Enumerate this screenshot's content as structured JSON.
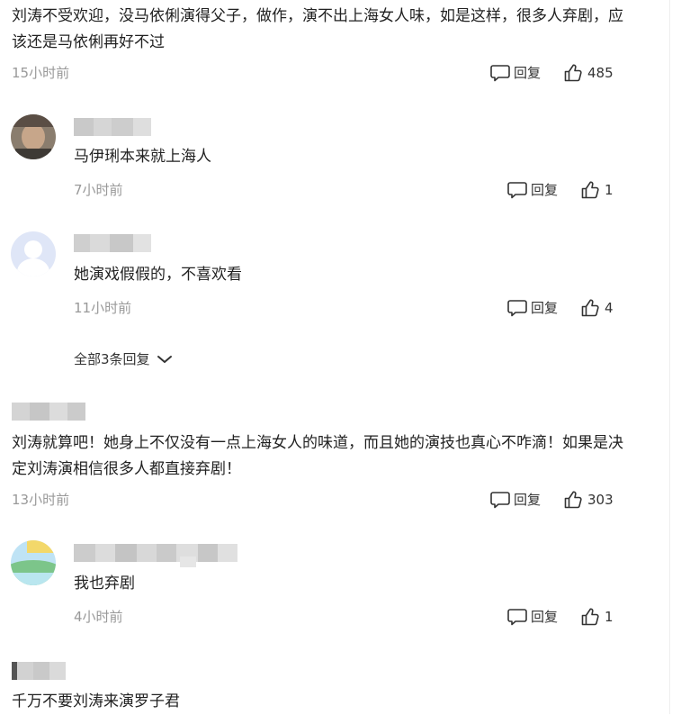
{
  "comments": [
    {
      "text": "刘涛不受欢迎，没马依俐演得父子，做作，演不出上海女人味，如是这样，很多人弃剧，应该还是马依俐再好不过",
      "time": "15小时前",
      "reply_label": "回复",
      "likes": "485"
    },
    {
      "text": "马伊琍本来就上海人",
      "time": "7小时前",
      "reply_label": "回复",
      "likes": "1"
    },
    {
      "text": "她演戏假假的，不喜欢看",
      "time": "11小时前",
      "reply_label": "回复",
      "likes": "4"
    },
    {
      "text": "刘涛就算吧！她身上不仅没有一点上海女人的味道，而且她的演技也真心不咋滴！如果是决定刘涛演相信很多人都直接弃剧！",
      "time": "13小时前",
      "reply_label": "回复",
      "likes": "303"
    },
    {
      "text": "我也弃剧",
      "time": "4小时前",
      "reply_label": "回复",
      "likes": "1"
    },
    {
      "text": "千万不要刘涛来演罗子君"
    }
  ],
  "expand_replies": "全部3条回复",
  "colors": {
    "text": "#222222",
    "muted": "#999999",
    "icon": "#333333"
  }
}
